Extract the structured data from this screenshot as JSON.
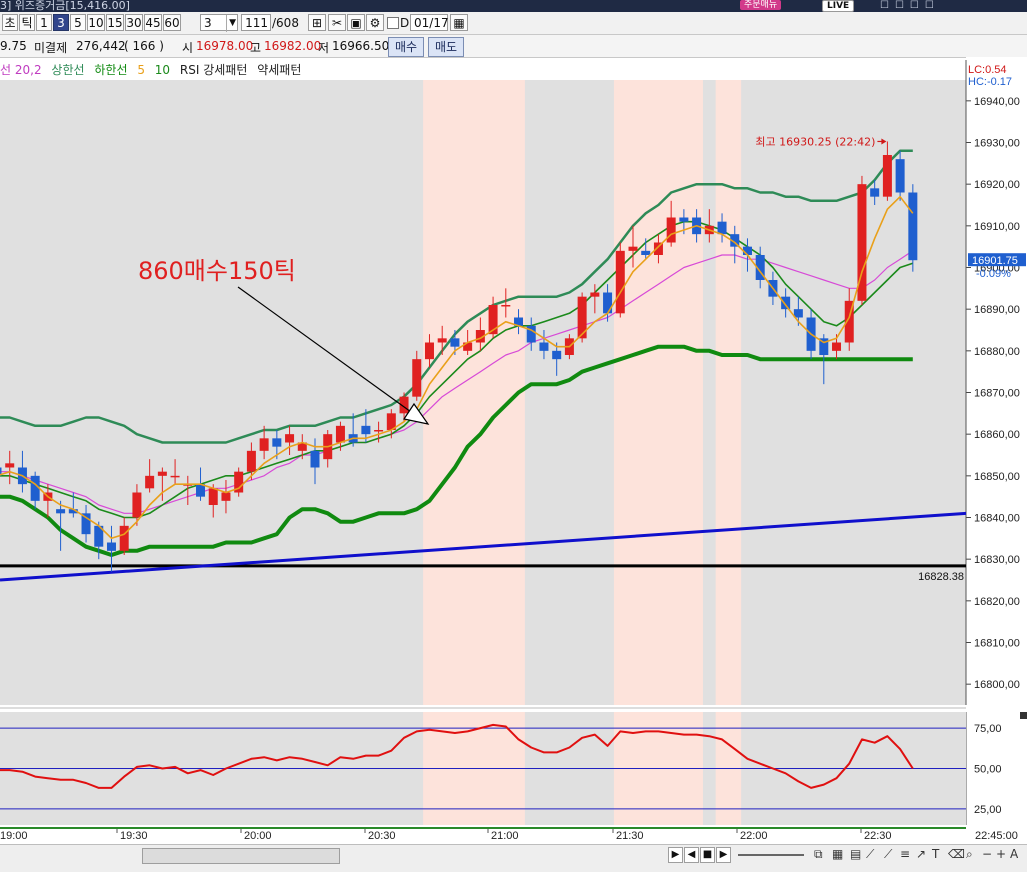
{
  "window": {
    "title": "3] 위즈증거금[15,416.00]",
    "order_badge": "주문매뉴",
    "live_badge": "LIVE"
  },
  "toolbar": {
    "period_labels": [
      "초",
      "틱",
      "1",
      "3",
      "5",
      "10",
      "15",
      "30",
      "45",
      "60"
    ],
    "active_period": "3",
    "interval_value": "3",
    "tick_count": "111",
    "tick_total": "/608",
    "date_value": "01/17",
    "date_prefix": "D"
  },
  "quote": {
    "prev_fragment": "9.75",
    "unsettled_label": "미결제",
    "unsettled_value": "276,442",
    "unsettled_change": "( 166 )",
    "open_label": "시",
    "open_value": "16978.00",
    "high_label": "고",
    "high_value": "16982.00",
    "low_label": "저",
    "low_value": "16966.50",
    "buy_button": "매수",
    "sell_button": "매도"
  },
  "legend": {
    "item1": "선 20,2",
    "item2": "상한선",
    "item3": "하한선",
    "item4": "5",
    "item5": "10",
    "item6": "RSI 강세패턴",
    "item7": "약세패턴"
  },
  "right_panel": {
    "lc": "LC:0.54",
    "hc": "HC:-0.17",
    "current_price": "16901.75",
    "current_change": "-0.09%"
  },
  "annotations": {
    "buy_note": "860매수150틱",
    "high_note": "최고 16930.25 (22:42)",
    "support_value": "16828.38"
  },
  "colors": {
    "up_candle": "#e02121",
    "down_candle": "#1f5fcf",
    "ma5": "#e9a01a",
    "ma10": "#d74ad7",
    "bb_upper": "#2e8b57",
    "bb_mid": "#1b8a1b",
    "bb_lower_thick": "#108a10",
    "trendline": "#1010cc",
    "rsi": "#e01010",
    "shade": "#fde3db"
  },
  "chart_data": {
    "type": "candlestick",
    "ylim": [
      16795,
      16945
    ],
    "yticks": [
      16800,
      16810,
      16820,
      16830,
      16840,
      16850,
      16860,
      16870,
      16880,
      16890,
      16900,
      16910,
      16920,
      16930,
      16940
    ],
    "ytick_labels": [
      "16800,00",
      "16810,00",
      "16820,00",
      "16830,00",
      "16840,00",
      "16850,00",
      "16860,00",
      "16870,00",
      "16880,00",
      "16890,00",
      "16900,00",
      "16910,00",
      "16920,00",
      "16930,00",
      "16940,00"
    ],
    "xtick_labels": [
      "19:00",
      "19:30",
      "20:00",
      "20:30",
      "21:00",
      "21:30",
      "22:00",
      "22:30",
      "22:45:00"
    ],
    "candles": [
      {
        "o": 16852.0,
        "h": 16855.0,
        "l": 16848.0,
        "c": 16850.0
      },
      {
        "o": 16852.0,
        "h": 16856.0,
        "l": 16848.0,
        "c": 16853.0
      },
      {
        "o": 16852.0,
        "h": 16856.0,
        "l": 16846.0,
        "c": 16848.0
      },
      {
        "o": 16850.0,
        "h": 16851.0,
        "l": 16842.0,
        "c": 16844.0
      },
      {
        "o": 16844.0,
        "h": 16848.0,
        "l": 16840.0,
        "c": 16846.0
      },
      {
        "o": 16842.0,
        "h": 16844.0,
        "l": 16832.0,
        "c": 16841.0
      },
      {
        "o": 16842.0,
        "h": 16846.0,
        "l": 16840.0,
        "c": 16841.0
      },
      {
        "o": 16841.0,
        "h": 16843.0,
        "l": 16834.0,
        "c": 16836.0
      },
      {
        "o": 16838.0,
        "h": 16839.0,
        "l": 16830.0,
        "c": 16833.0
      },
      {
        "o": 16834.0,
        "h": 16838.0,
        "l": 16827.0,
        "c": 16832.0
      },
      {
        "o": 16832.0,
        "h": 16840.0,
        "l": 16831.0,
        "c": 16838.0
      },
      {
        "o": 16840.0,
        "h": 16848.0,
        "l": 16838.0,
        "c": 16846.0
      },
      {
        "o": 16847.0,
        "h": 16854.0,
        "l": 16846.0,
        "c": 16850.0
      },
      {
        "o": 16850.0,
        "h": 16852.0,
        "l": 16844.0,
        "c": 16851.0
      },
      {
        "o": 16850.0,
        "h": 16854.0,
        "l": 16848.0,
        "c": 16850.0
      },
      {
        "o": 16848.0,
        "h": 16850.0,
        "l": 16843.0,
        "c": 16848.0
      },
      {
        "o": 16848.0,
        "h": 16852.0,
        "l": 16844.0,
        "c": 16845.0
      },
      {
        "o": 16843.0,
        "h": 16848.0,
        "l": 16840.0,
        "c": 16847.0
      },
      {
        "o": 16844.0,
        "h": 16849.0,
        "l": 16841.0,
        "c": 16846.0
      },
      {
        "o": 16846.0,
        "h": 16852.0,
        "l": 16845.0,
        "c": 16851.0
      },
      {
        "o": 16851.0,
        "h": 16858.0,
        "l": 16849.0,
        "c": 16856.0
      },
      {
        "o": 16856.0,
        "h": 16862.0,
        "l": 16854.0,
        "c": 16859.0
      },
      {
        "o": 16859.0,
        "h": 16861.0,
        "l": 16854.0,
        "c": 16857.0
      },
      {
        "o": 16858.0,
        "h": 16862.0,
        "l": 16855.0,
        "c": 16860.0
      },
      {
        "o": 16856.0,
        "h": 16860.0,
        "l": 16854.0,
        "c": 16858.0
      },
      {
        "o": 16856.0,
        "h": 16859.0,
        "l": 16848.0,
        "c": 16852.0
      },
      {
        "o": 16854.0,
        "h": 16861.0,
        "l": 16852.0,
        "c": 16860.0
      },
      {
        "o": 16858.0,
        "h": 16863.0,
        "l": 16856.0,
        "c": 16862.0
      },
      {
        "o": 16860.0,
        "h": 16865.0,
        "l": 16857.0,
        "c": 16858.0
      },
      {
        "o": 16862.0,
        "h": 16866.0,
        "l": 16858.0,
        "c": 16860.0
      },
      {
        "o": 16861.0,
        "h": 16863.0,
        "l": 16858.0,
        "c": 16861.0
      },
      {
        "o": 16861.0,
        "h": 16866.0,
        "l": 16859.0,
        "c": 16865.0
      },
      {
        "o": 16865.0,
        "h": 16870.0,
        "l": 16863.0,
        "c": 16869.0
      },
      {
        "o": 16869.0,
        "h": 16880.0,
        "l": 16868.0,
        "c": 16878.0
      },
      {
        "o": 16878.0,
        "h": 16884.0,
        "l": 16876.0,
        "c": 16882.0
      },
      {
        "o": 16882.0,
        "h": 16886.0,
        "l": 16879.0,
        "c": 16883.0
      },
      {
        "o": 16883.0,
        "h": 16885.0,
        "l": 16879.0,
        "c": 16881.0
      },
      {
        "o": 16880.0,
        "h": 16885.0,
        "l": 16879.0,
        "c": 16882.0
      },
      {
        "o": 16882.0,
        "h": 16888.0,
        "l": 16880.0,
        "c": 16885.0
      },
      {
        "o": 16884.0,
        "h": 16893.0,
        "l": 16883.0,
        "c": 16891.0
      },
      {
        "o": 16891.0,
        "h": 16895.0,
        "l": 16888.0,
        "c": 16891.0
      },
      {
        "o": 16888.0,
        "h": 16890.0,
        "l": 16884.0,
        "c": 16886.0
      },
      {
        "o": 16886.0,
        "h": 16888.0,
        "l": 16880.0,
        "c": 16882.0
      },
      {
        "o": 16882.0,
        "h": 16885.0,
        "l": 16878.0,
        "c": 16880.0
      },
      {
        "o": 16880.0,
        "h": 16882.0,
        "l": 16874.0,
        "c": 16878.0
      },
      {
        "o": 16879.0,
        "h": 16884.0,
        "l": 16878.0,
        "c": 16883.0
      },
      {
        "o": 16883.0,
        "h": 16894.0,
        "l": 16882.0,
        "c": 16893.0
      },
      {
        "o": 16893.0,
        "h": 16896.0,
        "l": 16889.0,
        "c": 16894.0
      },
      {
        "o": 16894.0,
        "h": 16896.0,
        "l": 16887.0,
        "c": 16889.0
      },
      {
        "o": 16889.0,
        "h": 16906.0,
        "l": 16888.0,
        "c": 16904.0
      },
      {
        "o": 16904.0,
        "h": 16910.0,
        "l": 16900.0,
        "c": 16905.0
      },
      {
        "o": 16904.0,
        "h": 16907.0,
        "l": 16902.0,
        "c": 16903.0
      },
      {
        "o": 16903.0,
        "h": 16908.0,
        "l": 16901.0,
        "c": 16906.0
      },
      {
        "o": 16906.0,
        "h": 16916.0,
        "l": 16905.0,
        "c": 16912.0
      },
      {
        "o": 16912.0,
        "h": 16914.0,
        "l": 16908.0,
        "c": 16911.0
      },
      {
        "o": 16912.0,
        "h": 16914.0,
        "l": 16906.0,
        "c": 16908.0
      },
      {
        "o": 16908.0,
        "h": 16914.0,
        "l": 16906.0,
        "c": 16910.0
      },
      {
        "o": 16911.0,
        "h": 16913.0,
        "l": 16906.0,
        "c": 16908.0
      },
      {
        "o": 16908.0,
        "h": 16910.0,
        "l": 16901.0,
        "c": 16905.0
      },
      {
        "o": 16905.0,
        "h": 16907.0,
        "l": 16899.0,
        "c": 16903.0
      },
      {
        "o": 16903.0,
        "h": 16905.0,
        "l": 16895.0,
        "c": 16897.0
      },
      {
        "o": 16897.0,
        "h": 16899.0,
        "l": 16891.0,
        "c": 16893.0
      },
      {
        "o": 16893.0,
        "h": 16895.0,
        "l": 16888.0,
        "c": 16890.0
      },
      {
        "o": 16890.0,
        "h": 16893.0,
        "l": 16886.0,
        "c": 16888.0
      },
      {
        "o": 16888.0,
        "h": 16890.0,
        "l": 16878.0,
        "c": 16880.0
      },
      {
        "o": 16883.0,
        "h": 16884.0,
        "l": 16872.0,
        "c": 16879.0
      },
      {
        "o": 16880.0,
        "h": 16884.0,
        "l": 16878.0,
        "c": 16882.0
      },
      {
        "o": 16882.0,
        "h": 16895.0,
        "l": 16880.0,
        "c": 16892.0
      },
      {
        "o": 16892.0,
        "h": 16922.0,
        "l": 16891.0,
        "c": 16920.0
      },
      {
        "o": 16919.0,
        "h": 16921.0,
        "l": 16915.0,
        "c": 16917.0
      },
      {
        "o": 16917.0,
        "h": 16930.25,
        "l": 16916.0,
        "c": 16927.0
      },
      {
        "o": 16926.0,
        "h": 16928.0,
        "l": 16916.0,
        "c": 16918.0
      },
      {
        "o": 16918.0,
        "h": 16920.0,
        "l": 16899.0,
        "c": 16901.75
      }
    ],
    "ma5": [
      16850,
      16851,
      16850,
      16848,
      16845,
      16843,
      16842,
      16840,
      16838,
      16835,
      16836,
      16839,
      16843,
      16846,
      16848,
      16848,
      16848,
      16847,
      16846,
      16847,
      16850,
      16853,
      16855,
      16857,
      16858,
      16857,
      16857,
      16858,
      16859,
      16859,
      16860,
      16861,
      16863,
      16866,
      16872,
      16876,
      16880,
      16882,
      16883,
      16885,
      16887,
      16886,
      16885,
      16883,
      16881,
      16881,
      16884,
      16887,
      16889,
      16894,
      16899,
      16902,
      16905,
      16908,
      16909,
      16910,
      16909,
      16908,
      16906,
      16903,
      16899,
      16895,
      16891,
      16887,
      16884,
      16882,
      16883,
      16888,
      16899,
      16907,
      16914,
      16917,
      16913
    ],
    "ma10": [
      16851,
      16851,
      16850,
      16849,
      16848,
      16847,
      16846,
      16845,
      16843,
      16842,
      16841,
      16841,
      16842,
      16843,
      16844,
      16845,
      16846,
      16847,
      16847,
      16848,
      16849,
      16850,
      16852,
      16853,
      16855,
      16855,
      16856,
      16857,
      16858,
      16858,
      16859,
      16860,
      16861,
      16863,
      16866,
      16869,
      16871,
      16873,
      16875,
      16877,
      16879,
      16880,
      16882,
      16883,
      16884,
      16885,
      16886,
      16887,
      16888,
      16890,
      16892,
      16894,
      16896,
      16898,
      16900,
      16901,
      16902,
      16903,
      16903,
      16902,
      16902,
      16901,
      16900,
      16899,
      16898,
      16897,
      16896,
      16895,
      16895,
      16897,
      16900,
      16902,
      16904
    ],
    "bb_upper": [
      16864,
      16864,
      16863,
      16862,
      16862,
      16862,
      16863,
      16864,
      16864,
      16863,
      16862,
      16860,
      16859,
      16858,
      16858,
      16858,
      16858,
      16858,
      16858,
      16859,
      16860,
      16861,
      16861,
      16862,
      16862,
      16862,
      16863,
      16864,
      16864,
      16865,
      16866,
      16867,
      16869,
      16872,
      16876,
      16880,
      16884,
      16887,
      16889,
      16891,
      16892,
      16893,
      16893,
      16893,
      16893,
      16894,
      16896,
      16899,
      16902,
      16906,
      16910,
      16913,
      16915,
      16918,
      16919,
      16920,
      16920,
      16920,
      16919,
      16919,
      16918,
      16918,
      16917,
      16917,
      16916,
      16916,
      16916,
      16917,
      16918,
      16921,
      16925,
      16928,
      16928
    ],
    "bb_mid": [
      16850,
      16850,
      16849,
      16848,
      16847,
      16846,
      16845,
      16844,
      16842,
      16841,
      16840,
      16840,
      16841,
      16843,
      16845,
      16847,
      16848,
      16849,
      16850,
      16850,
      16851,
      16852,
      16853,
      16854,
      16855,
      16856,
      16856,
      16857,
      16858,
      16858,
      16859,
      16860,
      16862,
      16865,
      16869,
      16872,
      16875,
      16878,
      16880,
      16883,
      16885,
      16886,
      16886,
      16887,
      16888,
      16889,
      16891,
      16894,
      16897,
      16900,
      16903,
      16906,
      16908,
      16910,
      16911,
      16911,
      16910,
      16909,
      16907,
      16905,
      16903,
      16900,
      16896,
      16893,
      16890,
      16887,
      16886,
      16888,
      16891,
      16894,
      16897,
      16900,
      16901
    ],
    "bb_lower": [
      16845,
      16845,
      16844,
      16842,
      16840,
      16837,
      16835,
      16833,
      16832,
      16831,
      16832,
      16832,
      16833,
      16833,
      16833,
      16833,
      16833,
      16833,
      16834,
      16834,
      16834,
      16835,
      16836,
      16840,
      16842,
      16842,
      16841,
      16839,
      16839,
      16840,
      16841,
      16841,
      16841,
      16842,
      16844,
      16848,
      16852,
      16857,
      16860,
      16864,
      16867,
      16870,
      16872,
      16872,
      16872,
      16873,
      16875,
      16876,
      16877,
      16878,
      16879,
      16880,
      16881,
      16881,
      16881,
      16880,
      16880,
      16879,
      16879,
      16879,
      16878,
      16878,
      16878,
      16878,
      16878,
      16878,
      16878,
      16878,
      16878,
      16878,
      16878,
      16878,
      16878
    ],
    "trendline": {
      "from": 16825.0,
      "to": 16841.0
    },
    "support_level": 16828.38,
    "shaded_bars": [
      [
        34,
        41
      ],
      [
        49,
        55
      ],
      [
        57,
        58
      ]
    ],
    "rsi": {
      "ylim": [
        15,
        85
      ],
      "levels": [
        75,
        50,
        25
      ],
      "level_labels": [
        "75,00",
        "50,00",
        "25,00"
      ],
      "values": [
        49,
        49,
        48,
        45,
        44,
        43,
        43,
        41,
        38,
        38,
        45,
        51,
        52,
        50,
        51,
        47,
        49,
        46,
        50,
        53,
        56,
        57,
        55,
        57,
        56,
        54,
        52,
        57,
        56,
        58,
        58,
        61,
        69,
        73,
        74,
        73,
        72,
        73,
        75,
        77,
        76,
        68,
        63,
        60,
        60,
        63,
        69,
        71,
        64,
        73,
        72,
        73,
        73,
        72,
        71,
        71,
        70,
        68,
        62,
        56,
        53,
        50,
        47,
        42,
        38,
        40,
        44,
        53,
        68,
        66,
        70,
        62,
        50
      ]
    }
  }
}
